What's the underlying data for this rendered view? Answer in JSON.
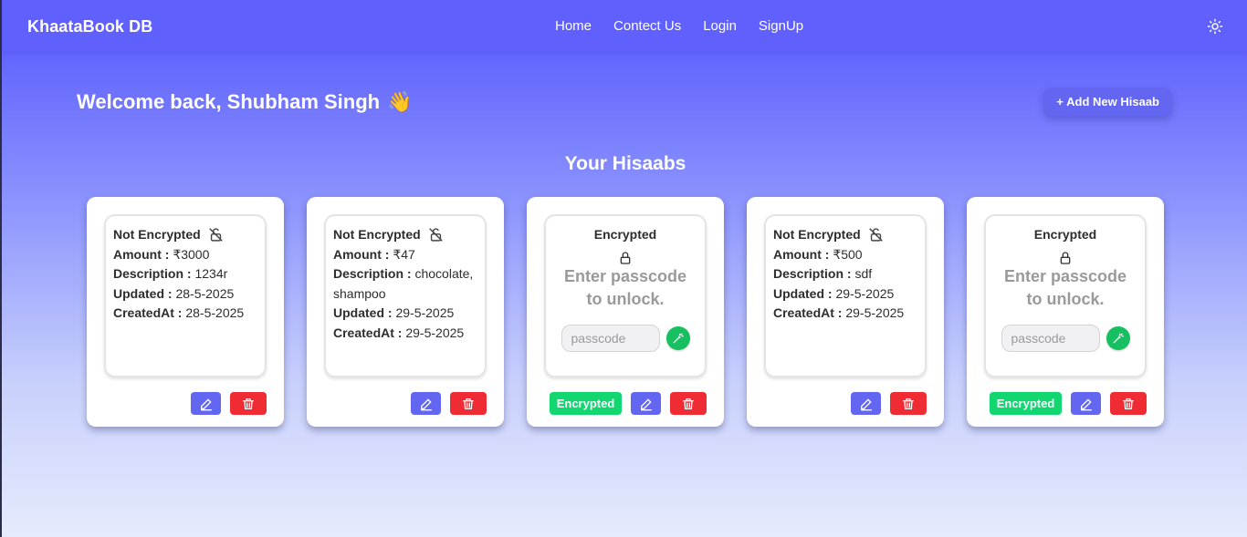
{
  "navbar": {
    "brand": "KhaataBook DB",
    "links": [
      "Home",
      "Contect Us",
      "Login",
      "SignUp"
    ],
    "theme_icon": "sun-icon"
  },
  "welcome": {
    "text": "Welcome back, Shubham Singh",
    "emoji": "👋",
    "add_button": "+ Add New Hisaab"
  },
  "section_title": "Your Hisaabs",
  "labels": {
    "amount": "Amount :",
    "description": "Description :",
    "updated": "Updated :",
    "created": "CreatedAt :",
    "not_encrypted": "Not Encrypted",
    "encrypted": "Encrypted",
    "hint_line1": "Enter passcode",
    "hint_line2": "to unlock.",
    "passcode_placeholder": "passcode",
    "encrypted_badge": "Encrypted"
  },
  "cards": [
    {
      "amount": "₹3000",
      "description": "1234r",
      "updated": "28-5-2025",
      "created": "28-5-2025"
    },
    {
      "amount": "₹47",
      "description": "chocolate, shampoo",
      "updated": "29-5-2025",
      "created": "29-5-2025"
    },
    {
      "encrypted": true
    },
    {
      "amount": "₹500",
      "description": "sdf",
      "updated": "29-5-2025",
      "created": "29-5-2025"
    },
    {
      "encrypted": true
    }
  ],
  "colors": {
    "primary": "#6366f1",
    "danger": "#ef2b33",
    "success": "#12d670"
  }
}
